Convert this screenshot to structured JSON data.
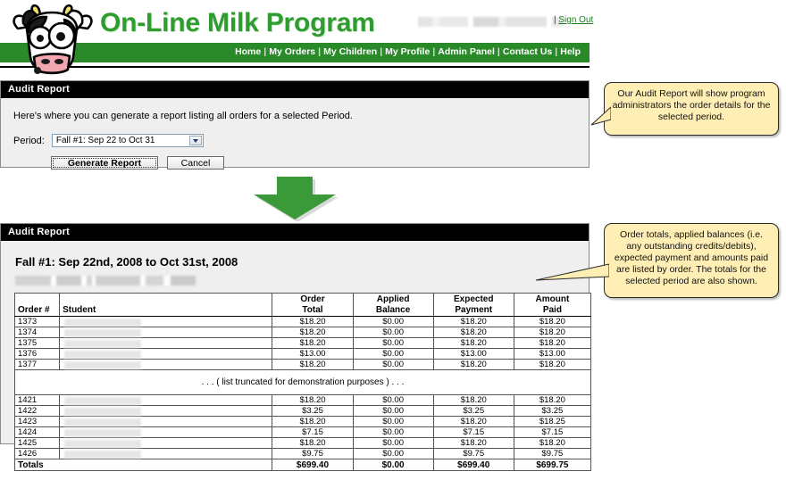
{
  "site": {
    "brand": "On-Line Milk Program",
    "sign_out": "Sign Out",
    "sign_out_separator": "|",
    "nav": [
      {
        "label": "Home"
      },
      {
        "label": "My Orders"
      },
      {
        "label": "My Children"
      },
      {
        "label": "My Profile"
      },
      {
        "label": "Admin Panel"
      },
      {
        "label": "Contact Us"
      },
      {
        "label": "Help"
      }
    ],
    "nav_separator": "|"
  },
  "panel1": {
    "header": "Audit Report",
    "intro": "Here's where you can generate a report listing all orders for a selected Period.",
    "period_label": "Period:",
    "period_value": "Fall #1: Sep 22 to Oct 31",
    "generate_label": "Generate Report",
    "cancel_label": "Cancel"
  },
  "panel2": {
    "header": "Audit Report",
    "title": "Fall #1: Sep 22nd, 2008 to Oct 31st, 2008",
    "columns": [
      "Order #",
      "Student",
      "Order Total",
      "Applied Balance",
      "Expected Payment",
      "Amount Paid"
    ],
    "columns_split": [
      {
        "line1": "Order #",
        "line2": ""
      },
      {
        "line1": "Student",
        "line2": ""
      },
      {
        "line1": "Order",
        "line2": "Total"
      },
      {
        "line1": "Applied",
        "line2": "Balance"
      },
      {
        "line1": "Expected",
        "line2": "Payment"
      },
      {
        "line1": "Amount",
        "line2": "Paid"
      }
    ],
    "rows_top": [
      {
        "order": "1373",
        "student": "",
        "order_total": "$18.20",
        "applied_balance": "$0.00",
        "expected_payment": "$18.20",
        "amount_paid": "$18.20"
      },
      {
        "order": "1374",
        "student": "",
        "order_total": "$18.20",
        "applied_balance": "$0.00",
        "expected_payment": "$18.20",
        "amount_paid": "$18.20"
      },
      {
        "order": "1375",
        "student": "",
        "order_total": "$18.20",
        "applied_balance": "$0.00",
        "expected_payment": "$18.20",
        "amount_paid": "$18.20"
      },
      {
        "order": "1376",
        "student": "",
        "order_total": "$13.00",
        "applied_balance": "$0.00",
        "expected_payment": "$13.00",
        "amount_paid": "$13.00"
      },
      {
        "order": "1377",
        "student": "",
        "order_total": "$18.20",
        "applied_balance": "$0.00",
        "expected_payment": "$18.20",
        "amount_paid": "$18.20"
      }
    ],
    "truncation_note": ". . . ( list truncated for demonstration purposes ) . . .",
    "rows_bottom": [
      {
        "order": "1421",
        "student": "",
        "order_total": "$18.20",
        "applied_balance": "$0.00",
        "expected_payment": "$18.20",
        "amount_paid": "$18.20"
      },
      {
        "order": "1422",
        "student": "",
        "order_total": "$3.25",
        "applied_balance": "$0.00",
        "expected_payment": "$3.25",
        "amount_paid": "$3.25"
      },
      {
        "order": "1423",
        "student": "",
        "order_total": "$18.20",
        "applied_balance": "$0.00",
        "expected_payment": "$18.20",
        "amount_paid": "$18.25"
      },
      {
        "order": "1424",
        "student": "",
        "order_total": "$7.15",
        "applied_balance": "$0.00",
        "expected_payment": "$7.15",
        "amount_paid": "$7.15"
      },
      {
        "order": "1425",
        "student": "",
        "order_total": "$18.20",
        "applied_balance": "$0.00",
        "expected_payment": "$18.20",
        "amount_paid": "$18.20"
      },
      {
        "order": "1426",
        "student": "",
        "order_total": "$9.75",
        "applied_balance": "$0.00",
        "expected_payment": "$9.75",
        "amount_paid": "$9.75"
      }
    ],
    "totals": {
      "label": "Totals",
      "order_total": "$699.40",
      "applied_balance": "$0.00",
      "expected_payment": "$699.40",
      "amount_paid": "$699.75"
    }
  },
  "callouts": {
    "first": "Our Audit Report will show program administrators  the order details for the selected period.",
    "second": "Order totals, applied balances (i.e. any outstanding credits/debits), expected payment and amounts paid are listed by order.  The totals for the selected period are also shown."
  },
  "colors": {
    "brand_green": "#2e9c2e",
    "nav_green": "#2a8a2a",
    "callout_yellow": "#ffefb5",
    "panel_header": "#000000"
  }
}
